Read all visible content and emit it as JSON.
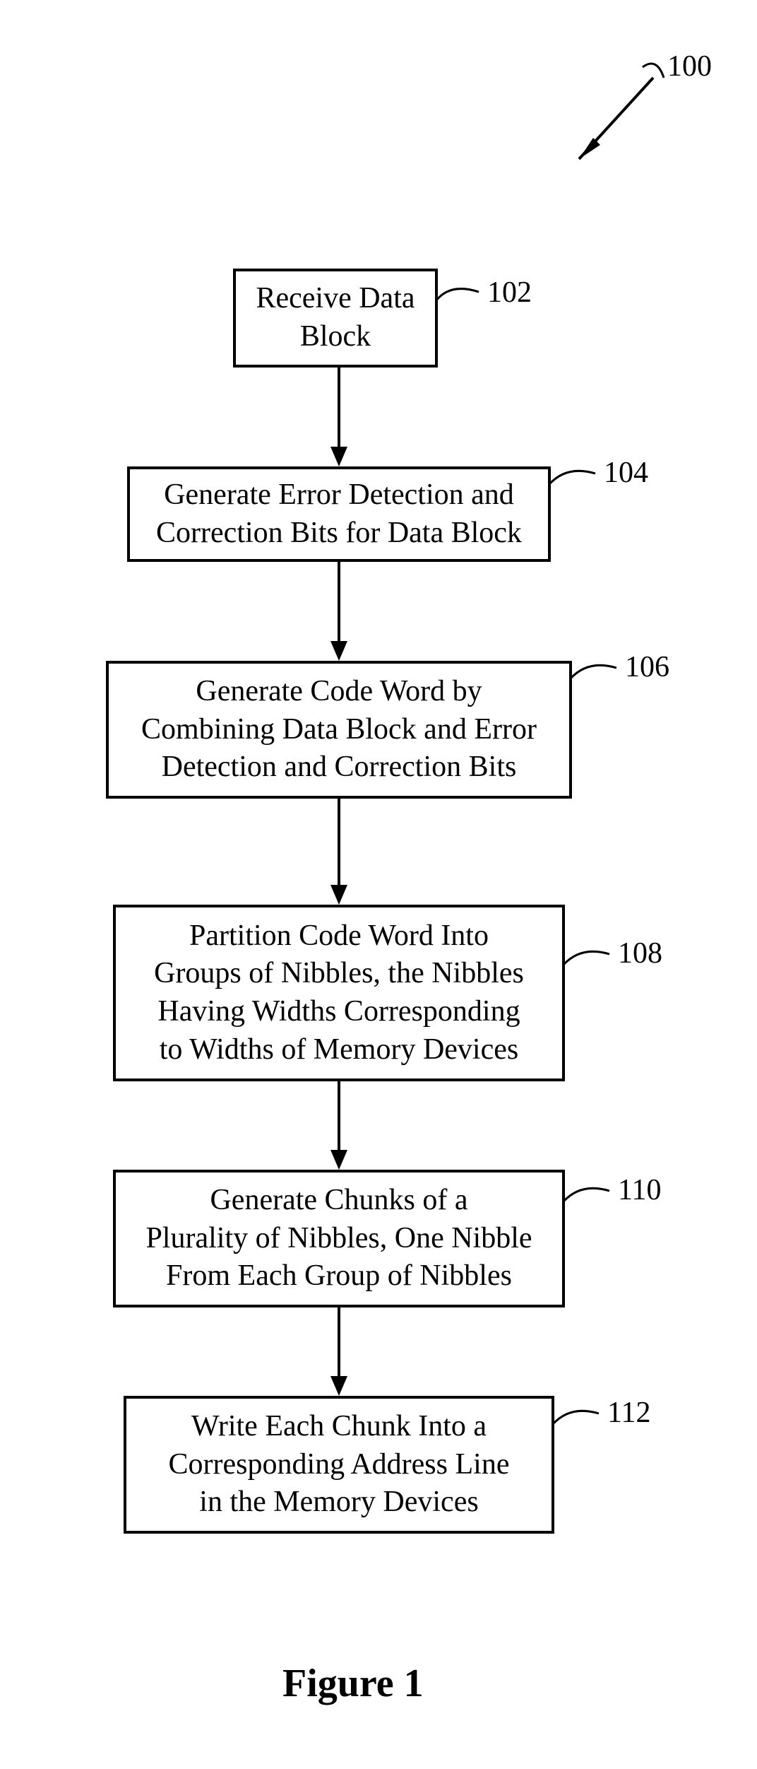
{
  "chart_data": {
    "type": "flowchart",
    "nodes": [
      {
        "id": "102",
        "text": "Receive Data Block"
      },
      {
        "id": "104",
        "text": "Generate Error Detection and Correction Bits for Data Block"
      },
      {
        "id": "106",
        "text": "Generate Code Word by Combining Data Block and Error Detection and Correction Bits"
      },
      {
        "id": "108",
        "text": "Partition Code Word Into Groups of Nibbles, the Nibbles Having  Widths Corresponding to Widths of Memory Devices"
      },
      {
        "id": "110",
        "text": "Generate Chunks of a Plurality of Nibbles, One Nibble From Each Group of Nibbles"
      },
      {
        "id": "112",
        "text": "Write Each Chunk Into a Corresponding Address Line in the Memory Devices"
      }
    ],
    "edges": [
      {
        "from": "102",
        "to": "104"
      },
      {
        "from": "104",
        "to": "106"
      },
      {
        "from": "106",
        "to": "108"
      },
      {
        "from": "108",
        "to": "110"
      },
      {
        "from": "110",
        "to": "112"
      }
    ],
    "figure_label": "Figure 1",
    "figure_ref": "100"
  },
  "nodes": {
    "n102": {
      "text": "Receive Data\nBlock",
      "label": "102"
    },
    "n104": {
      "text": "Generate Error Detection and\nCorrection Bits for Data Block",
      "label": "104"
    },
    "n106": {
      "text": "Generate Code Word by\nCombining Data Block and Error\nDetection and Correction Bits",
      "label": "106"
    },
    "n108": {
      "text": "Partition Code Word Into\nGroups of Nibbles, the Nibbles\nHaving  Widths Corresponding\nto Widths of Memory Devices",
      "label": "108"
    },
    "n110": {
      "text": "Generate Chunks of a\nPlurality of Nibbles, One Nibble\nFrom Each Group of Nibbles",
      "label": "110"
    },
    "n112": {
      "text": "Write Each Chunk Into a\nCorresponding Address Line\nin the Memory Devices",
      "label": "112"
    }
  },
  "figure": {
    "caption": "Figure 1",
    "ref": "100"
  }
}
